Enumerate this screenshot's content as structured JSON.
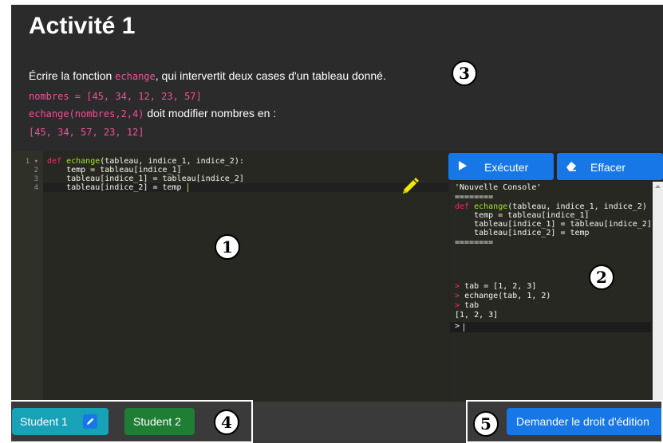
{
  "header": {
    "title": "Activité 1",
    "line1_before": "Écrire la fonction ",
    "line1_code": "echange",
    "line1_after": ", qui intervertit deux cases d'un tableau donné.",
    "line2_code": "nombres = [45, 34, 12, 23, 57]",
    "line3_code": "echange(nombres,2,4)",
    "line3_text": " doit modifier nombres en :",
    "line4_code": "[45, 34, 57, 23, 12]"
  },
  "editor": {
    "line_numbers": [
      "1",
      "2",
      "3",
      "4"
    ],
    "fold_marker": "▾",
    "code": [
      {
        "k": "def ",
        "f": "echange",
        "r": "(tableau, indice_1, indice_2):"
      },
      {
        "t": "    temp = tableau[indice_1]"
      },
      {
        "t": "    tableau[indice_1] = tableau[indice_2]"
      },
      {
        "t": "    tableau[indice_2] = temp"
      }
    ],
    "pencil_icon": "pencil-icon"
  },
  "console": {
    "run_label": "Exécuter",
    "clear_label": "Effacer",
    "run_icon": "play-icon",
    "clear_icon": "eraser-icon",
    "header_string": "'Nouvelle Console'",
    "separator": "========",
    "echo": [
      {
        "k": "def ",
        "f": "echange",
        "r": "(tableau, indice_1, indice_2)"
      },
      {
        "t": "    temp = tableau[indice_1]"
      },
      {
        "t": "    tableau[indice_1] = tableau[indice_2]"
      },
      {
        "t": "    tableau[indice_2] = temp"
      }
    ],
    "prompt": ">",
    "inputs": [
      "tab = [1, 2, 3]",
      "echange(tab, 1, 2)",
      "tab"
    ],
    "output": "[1, 2, 3]"
  },
  "footer": {
    "student1_label": "Student 1",
    "student2_label": "Student 2",
    "request_label": "Demander le droit d'édition"
  },
  "markers": [
    "1",
    "2",
    "3",
    "4",
    "5"
  ],
  "colors": {
    "accent": "#1877e6",
    "student1": "#17a2b8",
    "student2": "#1e7e34",
    "code_pink": "#f0519b"
  }
}
